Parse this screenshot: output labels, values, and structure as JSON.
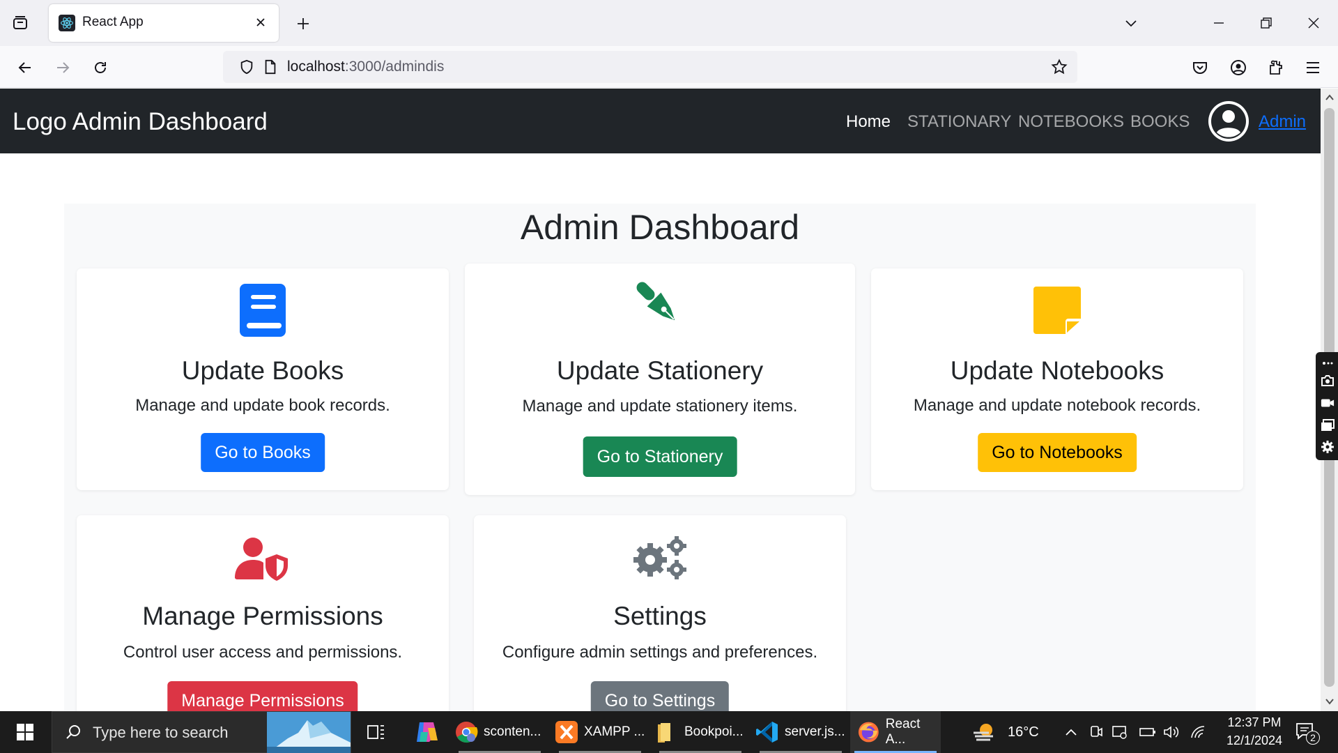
{
  "browser": {
    "tab_title": "React App",
    "url_host": "localhost",
    "url_rest": ":3000/admindis"
  },
  "app": {
    "brand": "Logo Admin Dashboard",
    "nav": [
      {
        "label": "Home",
        "active": true
      },
      {
        "label": "STATIONARY",
        "active": false
      },
      {
        "label": "NOTEBOOKS",
        "active": false
      },
      {
        "label": "BOOKS",
        "active": false
      }
    ],
    "user_link": "Admin"
  },
  "dashboard": {
    "title": "Admin Dashboard",
    "cards": [
      {
        "title": "Update Books",
        "text": "Manage and update book records.",
        "button": "Go to Books",
        "icon": "book-icon",
        "color": "#0d6efd"
      },
      {
        "title": "Update Stationery",
        "text": "Manage and update stationery items.",
        "button": "Go to Stationery",
        "icon": "pen-nib-icon",
        "color": "#198754"
      },
      {
        "title": "Update Notebooks",
        "text": "Manage and update notebook records.",
        "button": "Go to Notebooks",
        "icon": "sticky-note-icon",
        "color": "#ffc107"
      },
      {
        "title": "Manage Permissions",
        "text": "Control user access and permissions.",
        "button": "Manage Permissions",
        "icon": "user-shield-icon",
        "color": "#dc3545"
      },
      {
        "title": "Settings",
        "text": "Configure admin settings and preferences.",
        "button": "Go to Settings",
        "icon": "gears-icon",
        "color": "#6c757d"
      }
    ]
  },
  "taskbar": {
    "search_placeholder": "Type here to search",
    "apps": [
      {
        "label": "sconten...",
        "icon": "chrome-icon"
      },
      {
        "label": "XAMPP ...",
        "icon": "xampp-icon"
      },
      {
        "label": "Bookpoi...",
        "icon": "folder-icon"
      },
      {
        "label": "server.js...",
        "icon": "vscode-icon"
      },
      {
        "label": "React A...",
        "icon": "firefox-icon"
      }
    ],
    "weather": "16°C",
    "time": "12:37 PM",
    "date": "12/1/2024",
    "notification_count": "2"
  }
}
